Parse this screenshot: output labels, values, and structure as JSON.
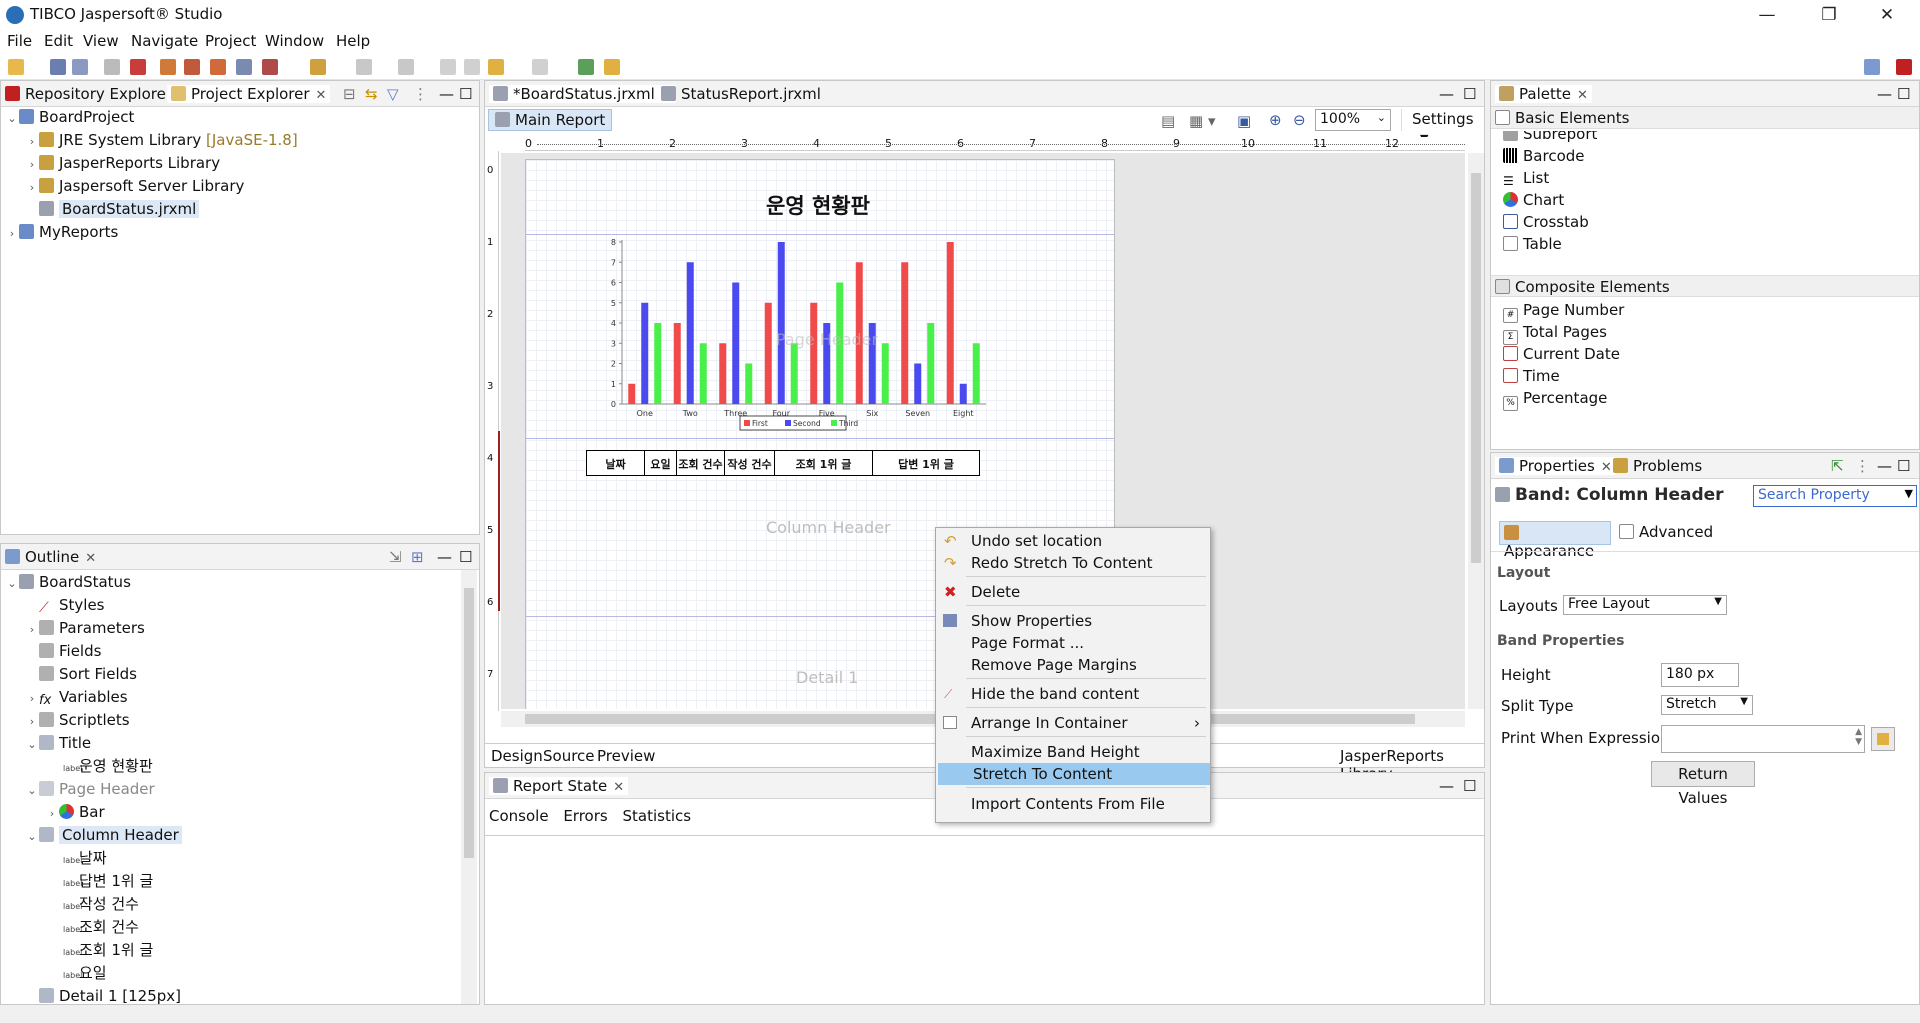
{
  "window": {
    "title": "TIBCO Jaspersoft® Studio",
    "min": "—",
    "max": "❐",
    "close": "✕"
  },
  "menu": [
    "File",
    "Edit",
    "View",
    "Navigate",
    "Project",
    "Window",
    "Help"
  ],
  "left_top": {
    "tabs": [
      "Repository Explorer",
      "Project Explorer"
    ],
    "tree": [
      {
        "label": "BoardProject"
      },
      {
        "label": "JRE System Library",
        "extra": "[JavaSE-1.8]"
      },
      {
        "label": "JasperReports Library"
      },
      {
        "label": "Jaspersoft Server Library"
      },
      {
        "label": "BoardStatus.jrxml"
      },
      {
        "label": "MyReports"
      }
    ]
  },
  "outline": {
    "tab": "Outline",
    "items": [
      "BoardStatus",
      "Styles",
      "Parameters",
      "Fields",
      "Sort Fields",
      "Variables",
      "Scriptlets",
      "Title",
      "운영 현황판",
      "Page Header",
      "Bar",
      "Column Header",
      "날짜",
      "답변 1위 글",
      "작성 건수",
      "조회 건수",
      "조회 1위 글",
      "요일",
      "Detail 1 [125px]"
    ],
    "fx": "fx",
    "label_tag": "label"
  },
  "editor": {
    "tabs": [
      "*BoardStatus.jrxml",
      "StatusReport.jrxml"
    ],
    "main_report": "Main Report",
    "zoom": "100%",
    "settings": "Settings",
    "bottom_tabs": [
      "Design",
      "Source",
      "Preview"
    ],
    "library": "JasperReports Library",
    "ruler": [
      "0",
      "1",
      "2",
      "3",
      "4",
      "5",
      "6",
      "7",
      "8",
      "9",
      "10",
      "11",
      "12"
    ],
    "vruler": [
      "0",
      "1",
      "2",
      "3",
      "4",
      "5",
      "6",
      "7"
    ],
    "report_title": "운영 현황판",
    "table_headers": [
      "날짜",
      "요일",
      "조회 건수",
      "작성 건수",
      "조회 1위 글",
      "답변 1위 글"
    ],
    "band_labels": [
      "Page Header",
      "Column Header",
      "Detail 1"
    ]
  },
  "chart_data": {
    "type": "bar",
    "categories": [
      "One",
      "Two",
      "Three",
      "Four",
      "Five",
      "Six",
      "Seven",
      "Eight"
    ],
    "series": [
      {
        "name": "First",
        "color": "#f04a4a",
        "values": [
          1,
          4,
          3,
          5,
          5,
          7,
          7,
          8
        ]
      },
      {
        "name": "Second",
        "color": "#4a4af0",
        "values": [
          5,
          7,
          6,
          8,
          4,
          4,
          2,
          1
        ]
      },
      {
        "name": "Third",
        "color": "#4af04a",
        "values": [
          4,
          3,
          2,
          3,
          6,
          3,
          4,
          3
        ]
      }
    ],
    "ylim": [
      0,
      8
    ],
    "yticks": [
      "0",
      "1",
      "2",
      "3",
      "4",
      "5",
      "6",
      "7",
      "8"
    ],
    "legend": "bottom"
  },
  "context_menu": {
    "items": [
      {
        "label": "Undo set location",
        "icon": "undo-icon"
      },
      {
        "label": "Redo Stretch To Content",
        "icon": "redo-icon"
      },
      {
        "label": "Delete",
        "icon": "delete-icon"
      },
      {
        "label": "Show Properties",
        "icon": "properties-icon"
      },
      {
        "label": "Page Format ..."
      },
      {
        "label": "Remove Page Margins"
      },
      {
        "label": "Hide the band content",
        "icon": "hide-icon"
      },
      {
        "label": "Arrange In Container",
        "icon": "arrange-icon"
      },
      {
        "label": "Maximize Band Height"
      },
      {
        "label": "Stretch To Content"
      },
      {
        "label": "Import Contents From File"
      }
    ]
  },
  "report_state": {
    "tab": "Report State",
    "tabs": [
      "Console",
      "Errors",
      "Statistics"
    ]
  },
  "palette": {
    "tab": "Palette",
    "basic_title": "Basic Elements",
    "basic": [
      "Subreport",
      "Barcode",
      "List",
      "Chart",
      "Crosstab",
      "Table"
    ],
    "composite_title": "Composite Elements",
    "composite": [
      "Page Number",
      "Total Pages",
      "Current Date",
      "Time",
      "Percentage"
    ]
  },
  "properties": {
    "tabs": [
      "Properties",
      "Problems"
    ],
    "heading": "Band: Column Header",
    "search_placeholder": "Search Property",
    "subtabs": [
      "Appearance",
      "Advanced"
    ],
    "layout_section": "Layout",
    "layouts_label": "Layouts",
    "layouts_value": "Free Layout",
    "band_section": "Band Properties",
    "height_label": "Height",
    "height_value": "180 px",
    "split_label": "Split Type",
    "split_value": "Stretch",
    "print_label": "Print When Expression",
    "return_values": "Return Values"
  }
}
